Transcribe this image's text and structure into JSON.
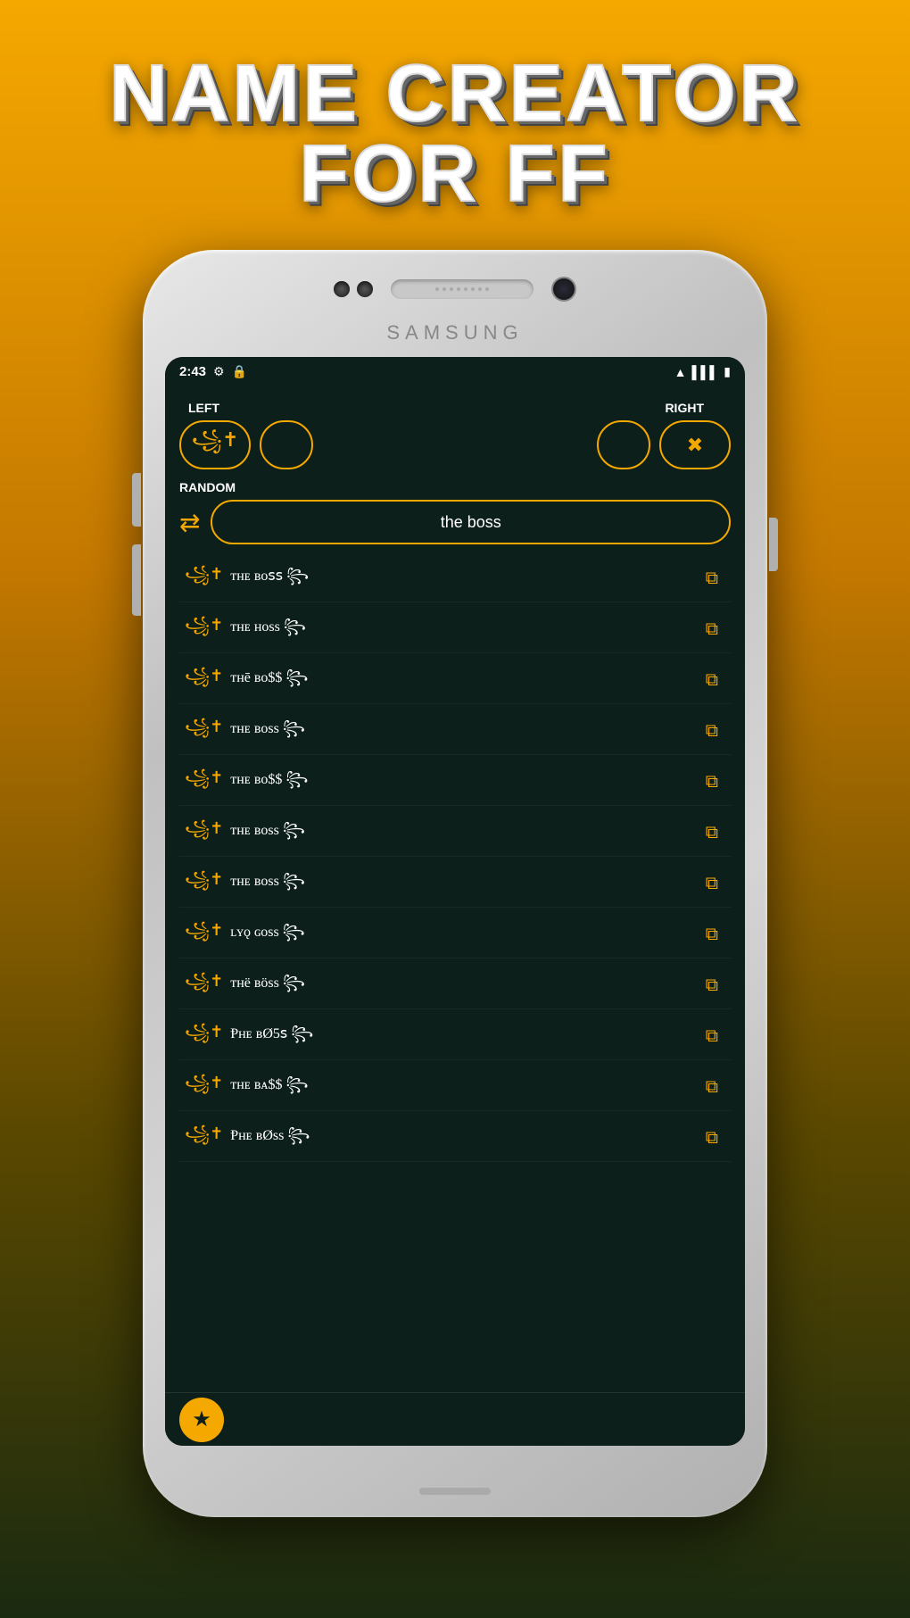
{
  "app": {
    "title_line1": "NAME CREATOR",
    "title_line2": "FOR FF"
  },
  "status_bar": {
    "time": "2:43",
    "settings_icon": "⚙",
    "lock_icon": "🔒",
    "wifi": "▲",
    "signal": "▌▌▌",
    "battery": "▮"
  },
  "samsung_label": "SAMSUNG",
  "labels": {
    "left": "LEFT",
    "right": "RIGHT",
    "random": "RANDOM"
  },
  "buttons": {
    "sym1": "꧁✝",
    "sym2": "",
    "sym3": "",
    "sym4": "✖"
  },
  "input": {
    "value": "the boss",
    "placeholder": "the boss"
  },
  "names": [
    {
      "symbol": "꧁✝",
      "text": "ᴛʜᴇ ʙᴏꜱꜱ ꧂",
      "style": "normal"
    },
    {
      "symbol": "꧁✝",
      "text": "ᴛнᴇ ʜᴏss ꧂",
      "style": "normal"
    },
    {
      "symbol": "꧁✝",
      "text": "ᴛнē ʙo$$ ꧂",
      "style": "normal"
    },
    {
      "symbol": "꧁✝",
      "text": "ᴛнᴇ ʙoss ꧂",
      "style": "normal"
    },
    {
      "symbol": "꧁✝",
      "text": "ᴛнᴇ ʙo$$ ꧂",
      "style": "alt"
    },
    {
      "symbol": "꧁✝",
      "text": "ᴛнᴇ ʙᴏss ꧂",
      "style": "normal"
    },
    {
      "symbol": "꧁✝",
      "text": "ᴛнᴇ ʙoss ꧂",
      "style": "bold"
    },
    {
      "symbol": "꧁✝",
      "text": "ʟʏǫ ɢoss ꧂",
      "style": "flip"
    },
    {
      "symbol": "꧁✝",
      "text": "ᴛнë ʙöss ꧂",
      "style": "dots"
    },
    {
      "symbol": "꧁✝",
      "text": "Ᵽнᴇ ʙØ5ꜱ ꧂",
      "style": "bar"
    },
    {
      "symbol": "꧁✝",
      "text": "ᴛнᴇ ʙᴀ$$ ꧂",
      "style": "normal"
    },
    {
      "symbol": "꧁✝",
      "text": "Ᵽнᴇ ʙØss ꧂",
      "style": "bar2"
    }
  ]
}
